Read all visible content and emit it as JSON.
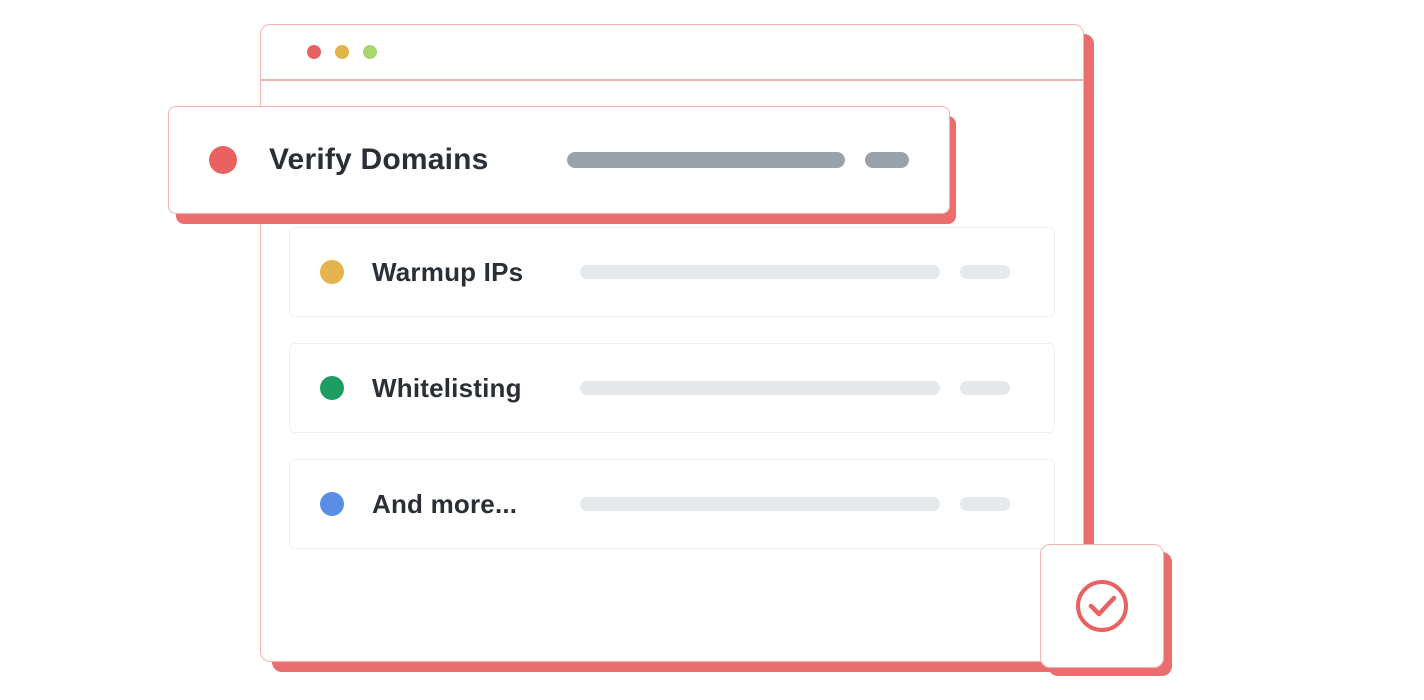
{
  "colors": {
    "accent": "#e96160",
    "trafficLights": [
      "#e96160",
      "#e3b44b",
      "#a6d86f"
    ],
    "dots": {
      "verify": "#e96160",
      "warmup": "#e3b44b",
      "whitelist": "#1e9d62",
      "more": "#5a8ee6"
    }
  },
  "items": {
    "verify": {
      "label": "Verify Domains"
    },
    "warmup": {
      "label": "Warmup IPs"
    },
    "whitelist": {
      "label": "Whitelisting"
    },
    "more": {
      "label": "And more..."
    }
  }
}
